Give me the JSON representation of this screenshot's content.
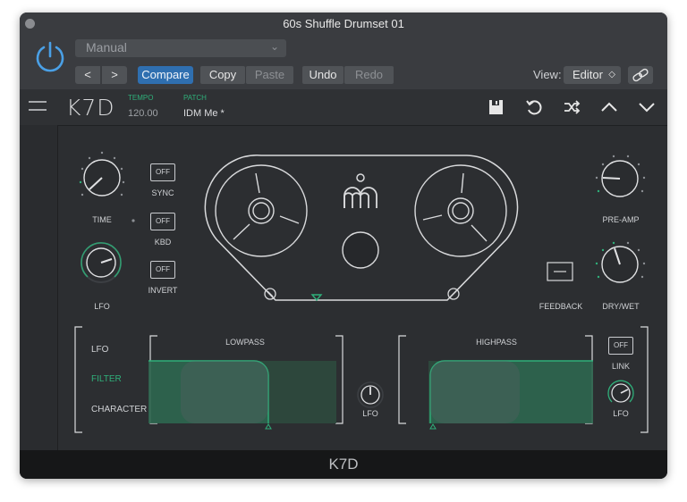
{
  "window": {
    "title": "60s Shuffle Drumset 01"
  },
  "header": {
    "preset": "Manual",
    "prev": "<",
    "next": ">",
    "compare": "Compare",
    "copy": "Copy",
    "paste": "Paste",
    "undo": "Undo",
    "redo": "Redo",
    "view_label": "View:",
    "view_value": "Editor",
    "accent": "#2f6fb0"
  },
  "plugin": {
    "logo": "K7D",
    "tempo_label": "TEMPO",
    "tempo_value": "120.00",
    "patch_label": "PATCH",
    "patch_value": "IDM Me *",
    "accent": "#2fb07a",
    "toolbar_icons": [
      "save-icon",
      "undo-icon",
      "shuffle-icon",
      "chevron-up-icon",
      "chevron-down-icon"
    ]
  },
  "controls": {
    "time": "TIME",
    "sync": "SYNC",
    "kbd": "KBD",
    "invert": "INVERT",
    "lfo": "LFO",
    "off": "OFF",
    "pre_amp": "PRE-AMP",
    "feedback": "FEEDBACK",
    "dry_wet": "DRY/WET"
  },
  "filter_section": {
    "tabs": [
      "LFO",
      "FILTER",
      "CHARACTER"
    ],
    "active_tab": "FILTER",
    "lowpass": "LOWPASS",
    "highpass": "HIGHPASS",
    "lfo": "LFO",
    "link": "LINK",
    "off": "OFF",
    "lfo2": "LFO"
  },
  "footer": {
    "title": "K7D"
  }
}
